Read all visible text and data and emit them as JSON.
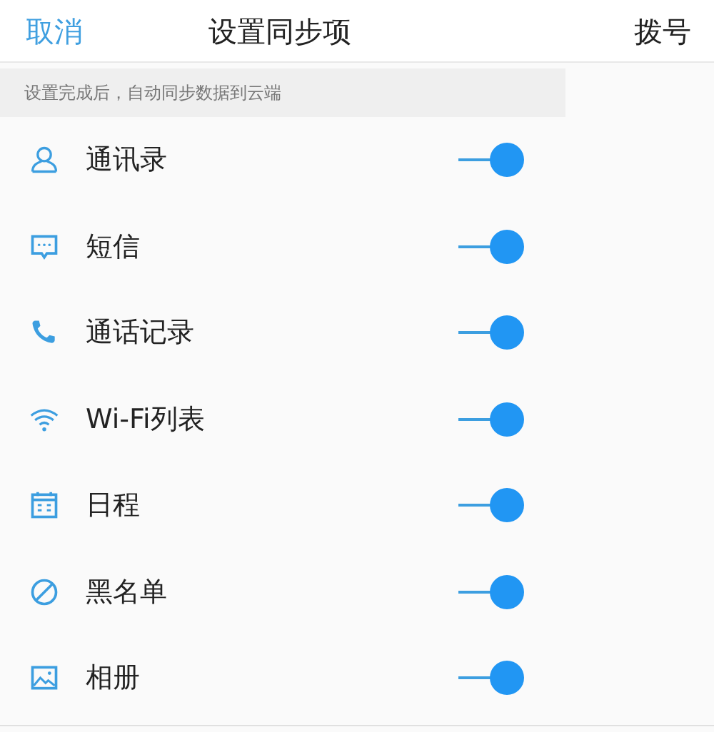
{
  "header": {
    "cancel": "取消",
    "title": "设置同步项",
    "action": "拨号"
  },
  "hint": "设置完成后，自动同步数据到云端",
  "items": [
    {
      "kind": "contacts",
      "label": "通讯录",
      "on": true
    },
    {
      "kind": "messages",
      "label": "短信",
      "on": true
    },
    {
      "kind": "calls",
      "label": "通话记录",
      "on": true
    },
    {
      "kind": "wifi",
      "label": "Wi-Fi列表",
      "on": true
    },
    {
      "kind": "calendar",
      "label": "日程",
      "on": true
    },
    {
      "kind": "blocklist",
      "label": "黑名单",
      "on": true
    },
    {
      "kind": "photos",
      "label": "相册",
      "on": true
    }
  ]
}
